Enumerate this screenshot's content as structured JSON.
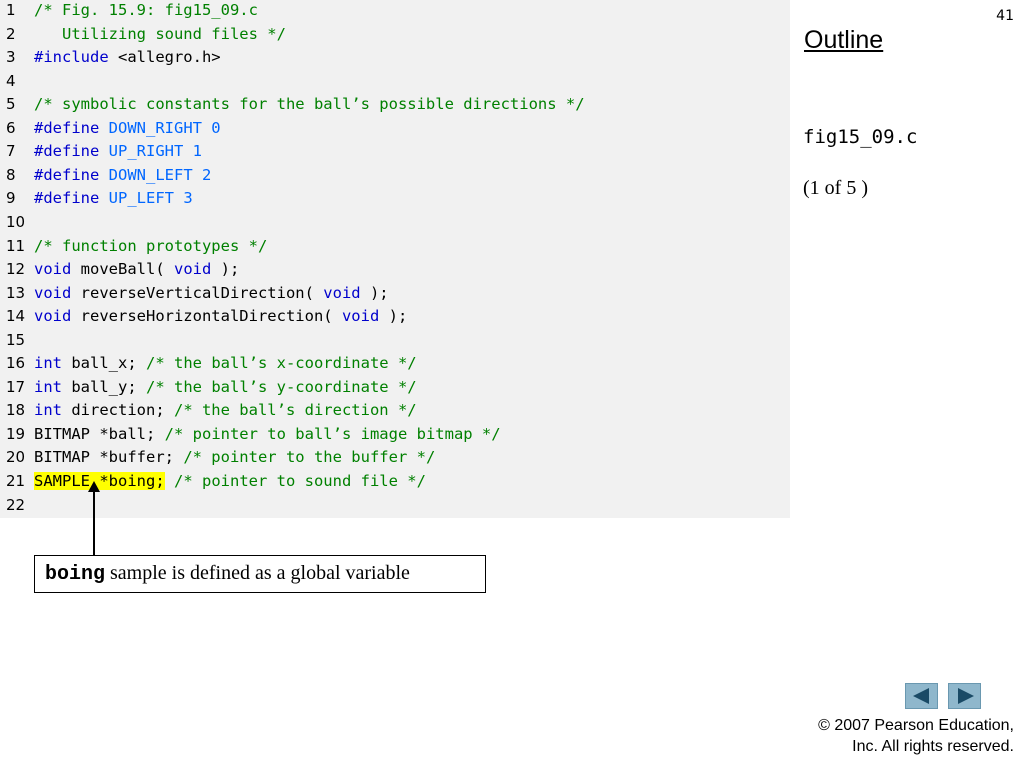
{
  "page_number": "41",
  "outline": {
    "title": "Outline",
    "file_name": "fig15_09.c",
    "page_of": "(1 of 5 )"
  },
  "code_lines": [
    {
      "n": "1",
      "segs": [
        {
          "t": "/* Fig. 15.9: fig15_09.c",
          "k": "comment"
        }
      ]
    },
    {
      "n": "2",
      "segs": [
        {
          "t": "   Utilizing sound files */",
          "k": "comment"
        }
      ]
    },
    {
      "n": "3",
      "segs": [
        {
          "t": "#include",
          "k": "pre"
        },
        {
          "t": " <allegro.h>",
          "k": "text"
        }
      ]
    },
    {
      "n": "4",
      "segs": []
    },
    {
      "n": "5",
      "segs": [
        {
          "t": "/* symbolic constants for the ball’s possible directions */",
          "k": "comment"
        }
      ]
    },
    {
      "n": "6",
      "segs": [
        {
          "t": "#define",
          "k": "pre"
        },
        {
          "t": " DOWN_RIGHT 0",
          "k": "const"
        }
      ]
    },
    {
      "n": "7",
      "segs": [
        {
          "t": "#define",
          "k": "pre"
        },
        {
          "t": " UP_RIGHT 1",
          "k": "const"
        }
      ]
    },
    {
      "n": "8",
      "segs": [
        {
          "t": "#define",
          "k": "pre"
        },
        {
          "t": " DOWN_LEFT 2",
          "k": "const"
        }
      ]
    },
    {
      "n": "9",
      "segs": [
        {
          "t": "#define",
          "k": "pre"
        },
        {
          "t": " UP_LEFT 3",
          "k": "const"
        }
      ]
    },
    {
      "n": "10",
      "segs": []
    },
    {
      "n": "11",
      "segs": [
        {
          "t": "/* function prototypes */",
          "k": "comment"
        }
      ]
    },
    {
      "n": "12",
      "segs": [
        {
          "t": "void",
          "k": "keyword"
        },
        {
          "t": " moveBall( ",
          "k": "text"
        },
        {
          "t": "void",
          "k": "keyword"
        },
        {
          "t": " );",
          "k": "text"
        }
      ]
    },
    {
      "n": "13",
      "segs": [
        {
          "t": "void",
          "k": "keyword"
        },
        {
          "t": " reverseVerticalDirection( ",
          "k": "text"
        },
        {
          "t": "void",
          "k": "keyword"
        },
        {
          "t": " );",
          "k": "text"
        }
      ]
    },
    {
      "n": "14",
      "segs": [
        {
          "t": "void",
          "k": "keyword"
        },
        {
          "t": " reverseHorizontalDirection( ",
          "k": "text"
        },
        {
          "t": "void",
          "k": "keyword"
        },
        {
          "t": " );",
          "k": "text"
        }
      ]
    },
    {
      "n": "15",
      "segs": []
    },
    {
      "n": "16",
      "segs": [
        {
          "t": "int",
          "k": "keyword"
        },
        {
          "t": " ball_x; ",
          "k": "text"
        },
        {
          "t": "/* the ball’s x-coordinate */",
          "k": "comment"
        }
      ]
    },
    {
      "n": "17",
      "segs": [
        {
          "t": "int",
          "k": "keyword"
        },
        {
          "t": " ball_y; ",
          "k": "text"
        },
        {
          "t": "/* the ball’s y-coordinate */",
          "k": "comment"
        }
      ]
    },
    {
      "n": "18",
      "segs": [
        {
          "t": "int",
          "k": "keyword"
        },
        {
          "t": " direction; ",
          "k": "text"
        },
        {
          "t": "/* the ball’s direction */",
          "k": "comment"
        }
      ]
    },
    {
      "n": "19",
      "segs": [
        {
          "t": "BITMAP *ball; ",
          "k": "text"
        },
        {
          "t": "/* pointer to ball’s image bitmap */",
          "k": "comment"
        }
      ]
    },
    {
      "n": "20",
      "segs": [
        {
          "t": "BITMAP *buffer; ",
          "k": "text"
        },
        {
          "t": "/* pointer to the buffer */",
          "k": "comment"
        }
      ]
    },
    {
      "n": "21",
      "segs": [
        {
          "t": "SAMPLE *boing;",
          "k": "text",
          "hl": true
        },
        {
          "t": " ",
          "k": "text"
        },
        {
          "t": "/* pointer to sound file */",
          "k": "comment"
        }
      ]
    },
    {
      "n": "22",
      "segs": []
    }
  ],
  "callout": {
    "code": "boing",
    "text": " sample is defined as a global variable"
  },
  "nav": {
    "prev_icon": "triangle-left-icon",
    "next_icon": "triangle-right-icon",
    "color": "#8fb7cc"
  },
  "copyright": {
    "line1": "© 2007 Pearson Education,",
    "line2": "Inc.  All rights reserved."
  },
  "colors": {
    "comment": "#008000",
    "keyword": "#0000cc",
    "constant": "#0066ff",
    "highlight": "#ffff00",
    "code_bg": "#f1f1f1"
  }
}
